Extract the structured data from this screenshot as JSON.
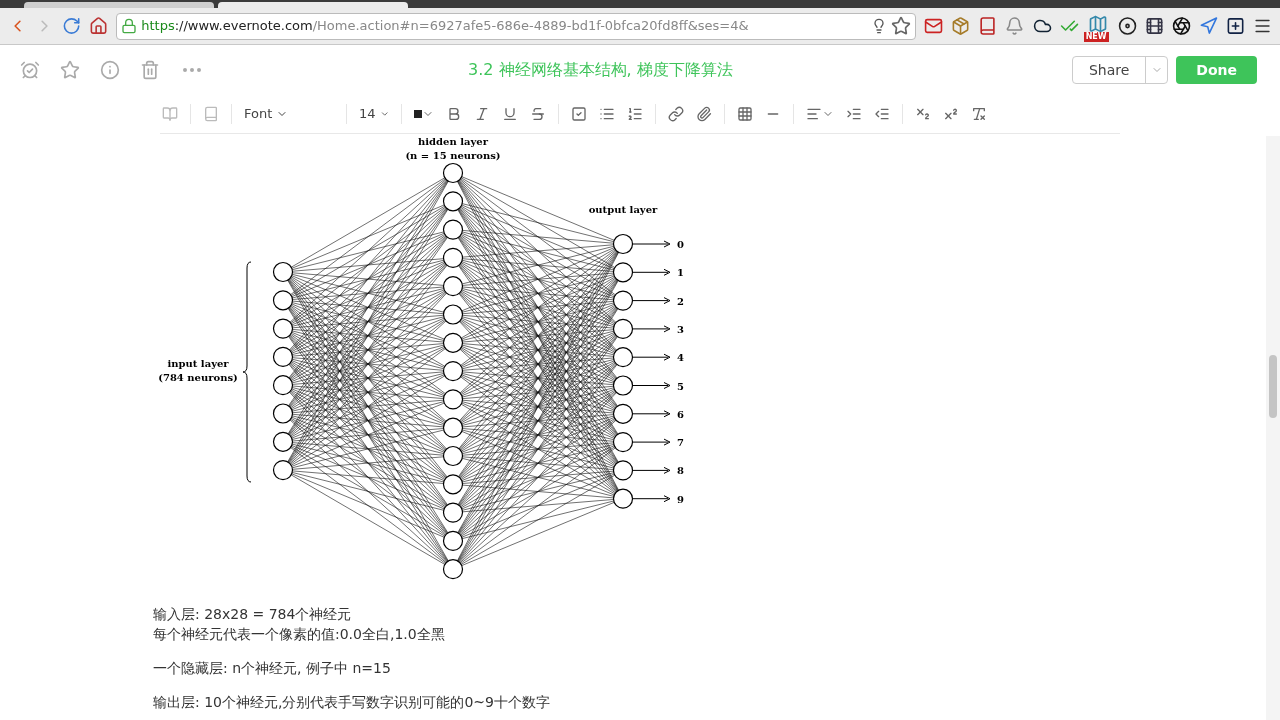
{
  "browser": {
    "url": {
      "scheme": "https",
      "host": "://www.evernote.com",
      "path": "/Home.action#n=6927afe5-686e-4889-bd1f-0bfca20fd8ff&ses=4&"
    },
    "extension_badge": "NEW"
  },
  "note": {
    "title": "3.2 神经网络基本结构, 梯度下降算法",
    "share": "Share",
    "done": "Done"
  },
  "toolbar": {
    "font": "Font",
    "size": "14"
  },
  "diagram": {
    "hidden_label": [
      "hidden layer",
      "(n = 15 neurons)"
    ],
    "output_label": "output layer",
    "input_label": [
      "input layer",
      "(784 neurons)"
    ],
    "outputs": [
      "0",
      "1",
      "2",
      "3",
      "4",
      "5",
      "6",
      "7",
      "8",
      "9"
    ]
  },
  "body": [
    [
      "输入层: 28x28 = 784个神经元",
      "每个神经元代表一个像素的值:0.0全白,1.0全黑"
    ],
    [
      "一个隐藏层: n个神经元, 例子中 n=15"
    ],
    [
      "输出层: 10个神经元,分别代表手写数字识别可能的0~9十个数字"
    ]
  ]
}
